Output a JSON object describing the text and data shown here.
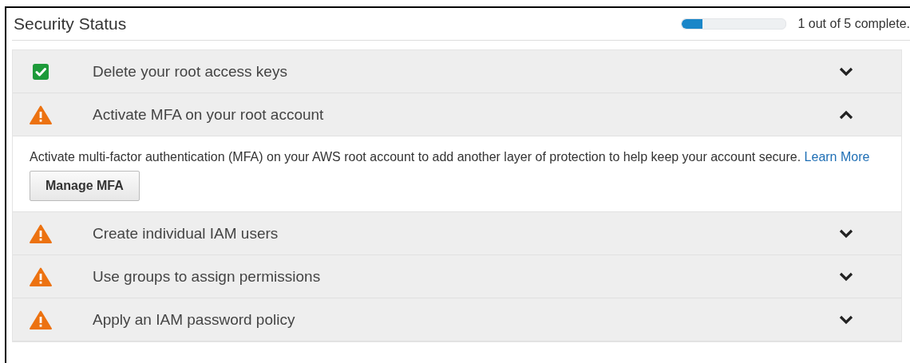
{
  "title": "Security Status",
  "progress": {
    "level": 0.2,
    "label": "1 out of 5 complete."
  },
  "items": [
    {
      "kind": "done",
      "label": "Delete your root access keys",
      "expanded": false
    },
    {
      "kind": "warning",
      "label": "Activate MFA on your root account",
      "expanded": true,
      "description": "Activate multi-factor authentication (MFA) on your AWS root account to add another layer of protection to help keep your account secure.",
      "link": "Learn More",
      "button": "Manage MFA"
    },
    {
      "kind": "warning",
      "label": "Create individual IAM users",
      "expanded": false
    },
    {
      "kind": "warning",
      "label": "Use groups to assign permissions",
      "expanded": false
    },
    {
      "kind": "warning",
      "label": "Apply an IAM password policy",
      "expanded": false
    }
  ]
}
